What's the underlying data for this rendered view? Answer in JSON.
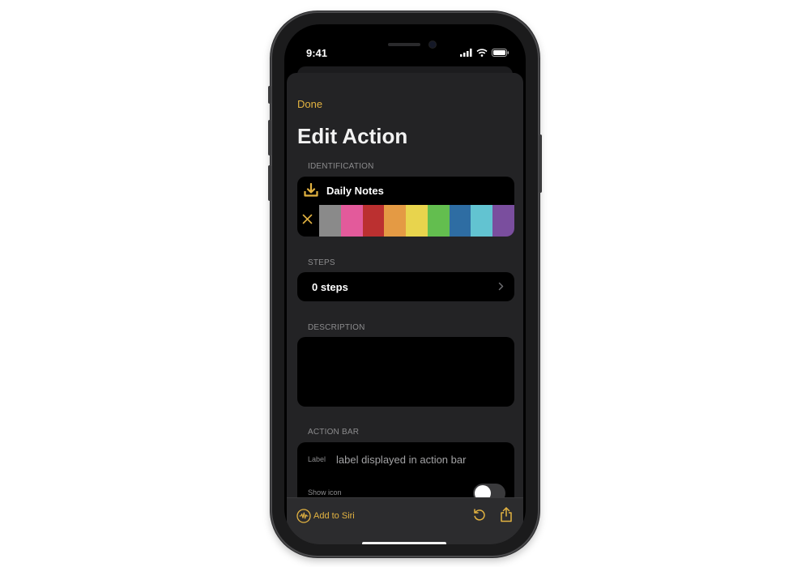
{
  "status": {
    "time": "9:41"
  },
  "header": {
    "done_label": "Done",
    "title": "Edit Action"
  },
  "identification": {
    "section_label": "IDENTIFICATION",
    "action_name": "Daily Notes",
    "icon": "download-tray-icon",
    "colors": [
      "#8a8a8a",
      "#e35a9b",
      "#bb3030",
      "#e49a44",
      "#e8d44d",
      "#63be4f",
      "#2e6da3",
      "#62c3d1",
      "#7a4e9e"
    ]
  },
  "steps": {
    "section_label": "STEPS",
    "value": "0 steps"
  },
  "description": {
    "section_label": "DESCRIPTION",
    "value": ""
  },
  "action_bar": {
    "section_label": "ACTION BAR",
    "label_field": {
      "label": "Label",
      "placeholder": "label displayed in action bar",
      "value": ""
    },
    "show_icon": {
      "label": "Show icon",
      "on": false
    }
  },
  "toolbar": {
    "siri_label": "Add to Siri"
  },
  "colors": {
    "accent": "#e3b341",
    "sheet": "#232325",
    "group": "#000000"
  }
}
